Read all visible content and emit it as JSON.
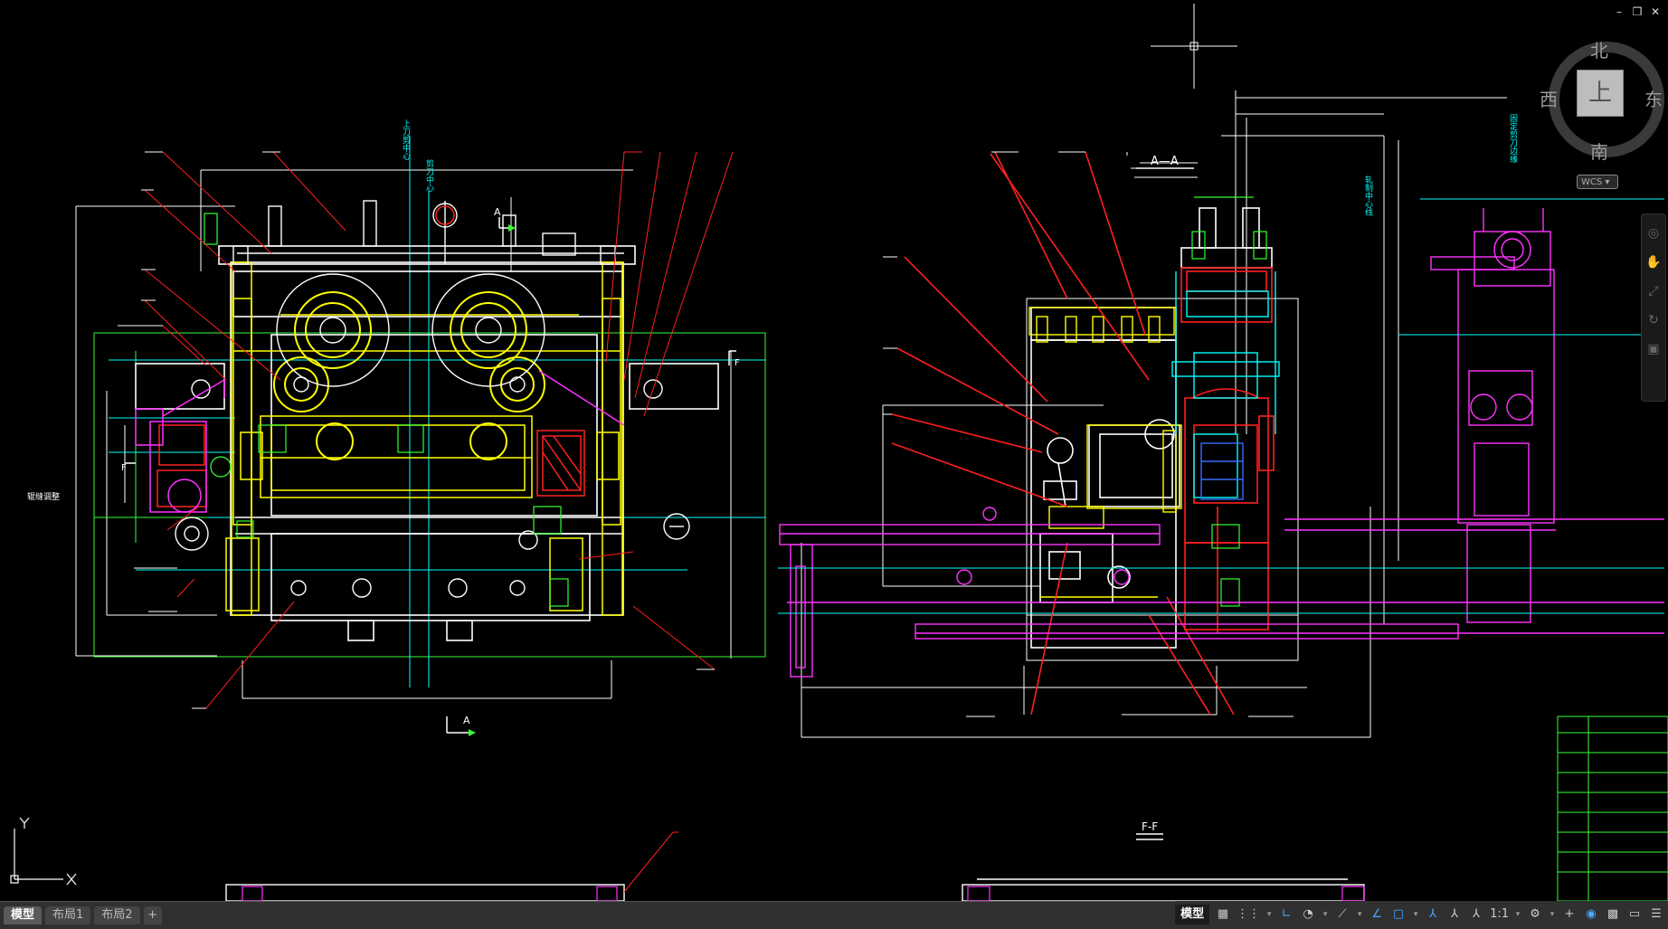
{
  "drawing": {
    "section_aa_label": "A—A",
    "section_ff_label": "F-F",
    "section_a_top": "A",
    "section_a_bottom": "A",
    "marker_f": "F",
    "marker_f_side": "F",
    "vtext_upper_blade": "上刀剪中心",
    "vtext_shear_center": "剪刀中心",
    "vtext_fixed_blade": "固定剪刀边缘",
    "vtext_roll_center": "轧制中心线",
    "left_note": "辊缝调整"
  },
  "viewcube": {
    "north": "北",
    "south": "南",
    "west": "西",
    "east": "东",
    "face": "上",
    "wcs": "WCS"
  },
  "layout_tabs": [
    "模型",
    "布局1",
    "布局2",
    "+"
  ],
  "statusbar": {
    "model": "模型",
    "scale": "1:1"
  },
  "colors": {
    "background": "#000000",
    "red": "#ff2020",
    "yellow": "#ffff00",
    "white": "#ffffff",
    "magenta": "#ff33ff",
    "cyan": "#00ffff",
    "green": "#33ff33"
  }
}
